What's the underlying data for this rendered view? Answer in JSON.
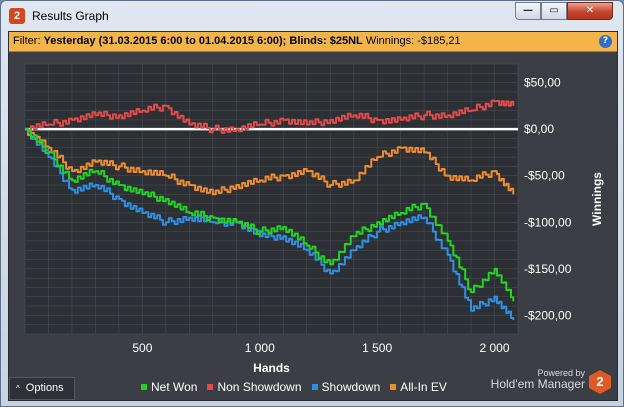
{
  "window": {
    "title": "Results Graph",
    "icon_glyph": "2",
    "controls": {
      "minimize": "—",
      "maximize": "▭",
      "close": "✕"
    }
  },
  "filter": {
    "label": "Filter:",
    "date_range": "Yesterday (31.03.2015 6:00 to 01.04.2015 6:00);",
    "blinds_label": "Blinds:",
    "blinds_value": "$25NL",
    "winnings_label": "Winnings:",
    "winnings_value": "-$185,21",
    "help_glyph": "?"
  },
  "bottom": {
    "options_label": "Options",
    "options_chevron": "^",
    "powered_by": "Powered by",
    "brand": "Hold'em Manager",
    "brand_logo": "2"
  },
  "colors": {
    "net_won": "#22d322",
    "non_showdown": "#e34a4a",
    "showdown": "#2f8fe3",
    "all_in_ev": "#ee8c30",
    "zero_line": "#ffffff",
    "grid": "#4b5057",
    "plot_bg": "#2c2f33"
  },
  "chart_data": {
    "type": "line",
    "xlabel": "Hands",
    "ylabel": "Winnings",
    "xlim": [
      0,
      2100
    ],
    "ylim": [
      -220,
      70
    ],
    "x_ticks": [
      500,
      1000,
      1500,
      2000
    ],
    "x_tick_labels": [
      "500",
      "1 000",
      "1 500",
      "2 000"
    ],
    "y_ticks": [
      50,
      0,
      -50,
      -100,
      -150,
      -200
    ],
    "y_tick_labels": [
      "$50,00",
      "$0,00",
      "-$50,00",
      "-$100,00",
      "-$150,00",
      "-$200,00"
    ],
    "zero_line": 0,
    "grid": true,
    "legend_position": "bottom",
    "x": [
      0,
      100,
      200,
      300,
      400,
      500,
      600,
      700,
      800,
      900,
      1000,
      1100,
      1200,
      1300,
      1400,
      1500,
      1600,
      1700,
      1800,
      1900,
      2000,
      2080
    ],
    "series": [
      {
        "name": "Net Won",
        "color_key": "net_won",
        "values": [
          0,
          -25,
          -55,
          -45,
          -60,
          -70,
          -75,
          -90,
          -95,
          -100,
          -110,
          -105,
          -125,
          -145,
          -115,
          -100,
          -90,
          -80,
          -120,
          -175,
          -150,
          -185
        ]
      },
      {
        "name": "Non Showdown",
        "color_key": "non_showdown",
        "values": [
          0,
          5,
          10,
          15,
          15,
          20,
          25,
          5,
          0,
          0,
          5,
          10,
          5,
          10,
          15,
          10,
          10,
          15,
          15,
          20,
          30,
          25
        ]
      },
      {
        "name": "Showdown",
        "color_key": "showdown",
        "values": [
          0,
          -30,
          -65,
          -60,
          -75,
          -90,
          -100,
          -95,
          -100,
          -100,
          -115,
          -115,
          -130,
          -155,
          -130,
          -110,
          -100,
          -95,
          -135,
          -195,
          -180,
          -205
        ]
      },
      {
        "name": "All-In EV",
        "color_key": "all_in_ev",
        "values": [
          0,
          -20,
          -45,
          -35,
          -40,
          -45,
          -50,
          -60,
          -70,
          -60,
          -55,
          -50,
          -45,
          -60,
          -55,
          -30,
          -20,
          -25,
          -50,
          -55,
          -45,
          -70
        ]
      }
    ]
  }
}
